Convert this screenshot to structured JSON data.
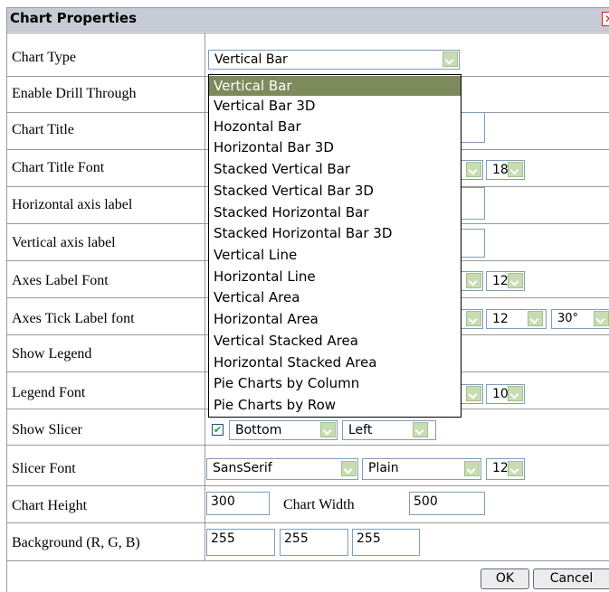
{
  "dialog": {
    "title": "Chart Properties",
    "close_label": "✕"
  },
  "rows": [
    {
      "label": "Chart Type"
    },
    {
      "label": "Enable Drill Through"
    },
    {
      "label": "Chart Title"
    },
    {
      "label": "Chart Title Font"
    },
    {
      "label": "Horizontal axis label"
    },
    {
      "label": "Vertical axis label"
    },
    {
      "label": "Axes Label Font"
    },
    {
      "label": "Axes Tick Label font"
    },
    {
      "label": "Show Legend"
    },
    {
      "label": "Legend Font"
    },
    {
      "label": "Show Slicer"
    },
    {
      "label": "Slicer Font"
    },
    {
      "label": "Chart Height"
    },
    {
      "label": "Background (R, G, B)"
    }
  ],
  "chart_type": {
    "selected": "Vertical Bar",
    "options": [
      "Vertical Bar",
      "Vertical Bar 3D",
      "Hozontal Bar",
      "Horizontal Bar 3D",
      "Stacked Vertical Bar",
      "Stacked Vertical Bar 3D",
      "Stacked Horizontal Bar",
      "Stacked Horizontal Bar 3D",
      "Vertical Line",
      "Horizontal Line",
      "Vertical Area",
      "Horizontal Area",
      "Vertical Stacked Area",
      "Horizontal Stacked Area",
      "Pie Charts by Column",
      "Pie Charts by Row"
    ]
  },
  "sizes": {
    "chart_title_font_size": "18",
    "axes_label_font_size": "12",
    "axes_tick_font_size": "12",
    "axes_tick_rotation": "30°",
    "legend_font_size": "10"
  },
  "slicer": {
    "checked": "✔",
    "position": "Bottom",
    "alignment": "Left",
    "font_family": "SansSerif",
    "font_style": "Plain",
    "font_size": "12"
  },
  "dimensions": {
    "height_value": "300",
    "width_label": "Chart Width",
    "width_value": "500"
  },
  "background": {
    "r": "255",
    "g": "255",
    "b": "255"
  },
  "buttons": {
    "ok": "OK",
    "cancel": "Cancel"
  }
}
